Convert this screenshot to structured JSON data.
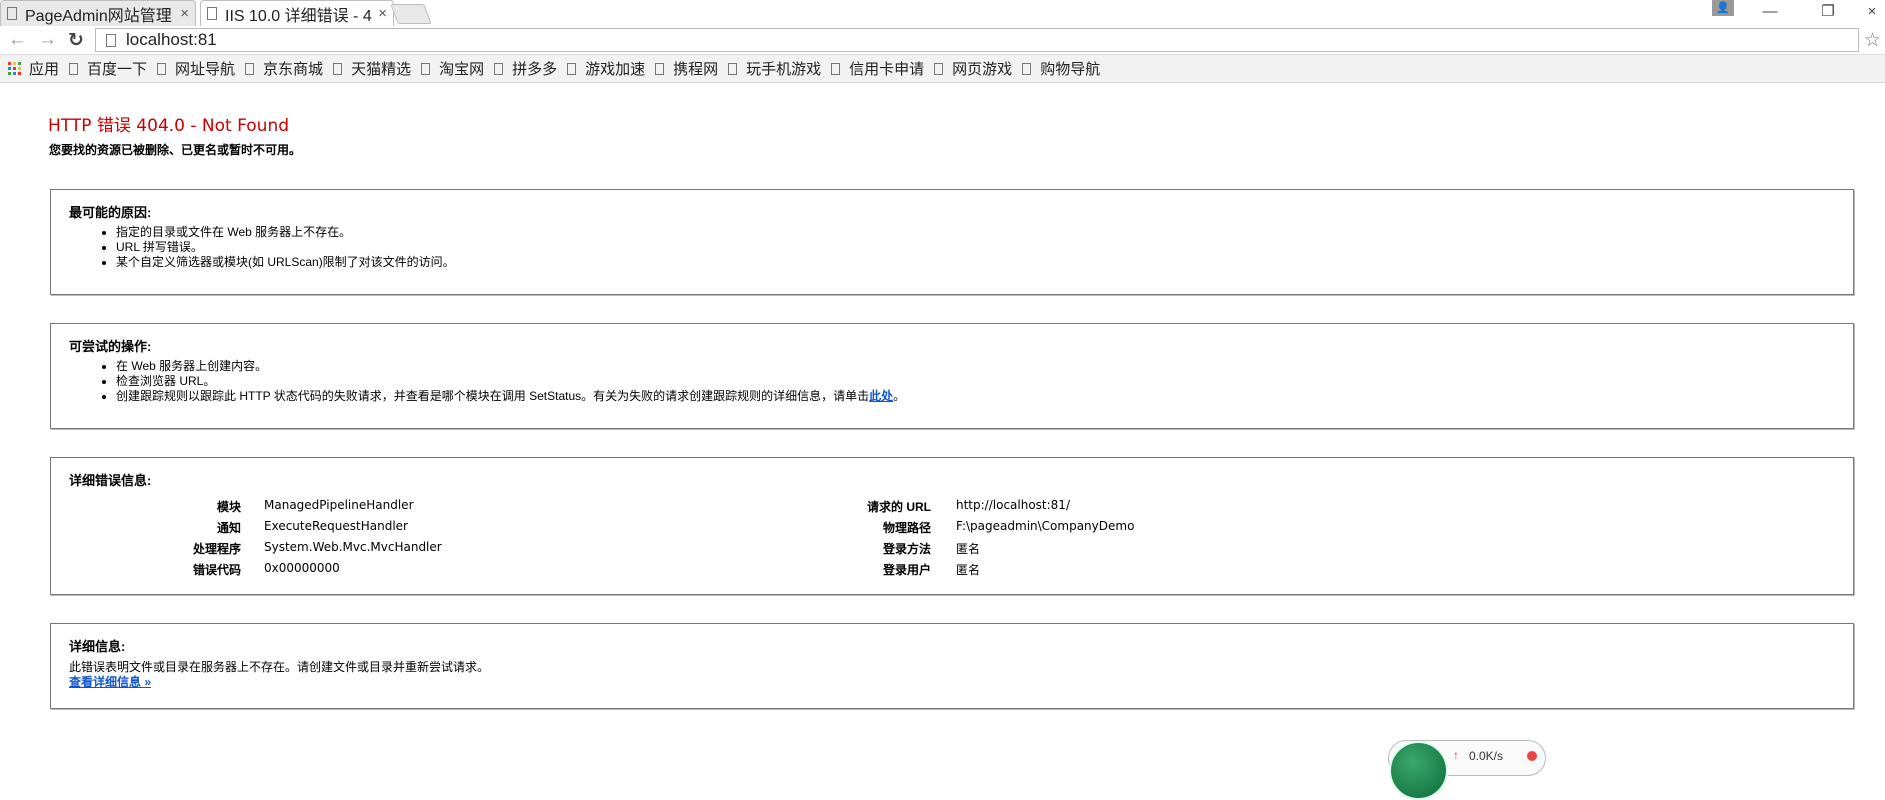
{
  "browser": {
    "tabs": [
      {
        "label": "PageAdmin网站管理",
        "active": false
      },
      {
        "label": "IIS 10.0 详细错误 - 4",
        "active": true
      }
    ],
    "close_glyph": "×",
    "url": "localhost:81",
    "nav": {
      "back": "←",
      "forward": "→",
      "reload": "C"
    },
    "bookmarks": [
      {
        "label": "应用",
        "icon": "apps-grid-icon"
      },
      {
        "label": "百度一下",
        "icon": "page-icon"
      },
      {
        "label": "网址导航",
        "icon": "page-icon"
      },
      {
        "label": "京东商城",
        "icon": "page-icon"
      },
      {
        "label": "天猫精选",
        "icon": "page-icon"
      },
      {
        "label": "淘宝网",
        "icon": "page-icon"
      },
      {
        "label": "拼多多",
        "icon": "page-icon"
      },
      {
        "label": "游戏加速",
        "icon": "page-icon"
      },
      {
        "label": "携程网",
        "icon": "page-icon"
      },
      {
        "label": "玩手机游戏",
        "icon": "page-icon"
      },
      {
        "label": "信用卡申请",
        "icon": "page-icon"
      },
      {
        "label": "网页游戏",
        "icon": "page-icon"
      },
      {
        "label": "购物导航",
        "icon": "page-icon"
      }
    ]
  },
  "page": {
    "title": "HTTP 错误 404.0 - Not Found",
    "subtitle": "您要找的资源已被删除、已更名或暂时不可用。",
    "causes": {
      "heading": "最可能的原因:",
      "items": [
        "指定的目录或文件在 Web 服务器上不存在。",
        "URL 拼写错误。",
        "某个自定义筛选器或模块(如 URLScan)限制了对该文件的访问。"
      ]
    },
    "actions": {
      "heading": "可尝试的操作:",
      "items": [
        "在 Web 服务器上创建内容。",
        "检查浏览器 URL。"
      ],
      "last_item_text": "创建跟踪规则以跟踪此 HTTP 状态代码的失败请求，并查看是哪个模块在调用 SetStatus。有关为失败的请求创建跟踪规则的详细信息，请单击",
      "last_item_link": "此处",
      "last_item_end": "。"
    },
    "details": {
      "heading": "详细错误信息:",
      "left": [
        {
          "key": "模块",
          "value": "ManagedPipelineHandler"
        },
        {
          "key": "通知",
          "value": "ExecuteRequestHandler"
        },
        {
          "key": "处理程序",
          "value": "System.Web.Mvc.MvcHandler"
        },
        {
          "key": "错误代码",
          "value": "0x00000000"
        }
      ],
      "right": [
        {
          "key": "请求的 URL",
          "value": "http://localhost:81/"
        },
        {
          "key": "物理路径",
          "value": "F:\\pageadmin\\CompanyDemo"
        },
        {
          "key": "登录方法",
          "value": "匿名"
        },
        {
          "key": "登录用户",
          "value": "匿名"
        }
      ]
    },
    "more": {
      "heading": "详细信息:",
      "text": "此错误表明文件或目录在服务器上不存在。请创建文件或目录并重新尝试请求。",
      "link": "查看详细信息 »"
    }
  },
  "widget": {
    "percent": "0.0K/s"
  },
  "colors": {
    "error_title": "#cc0000",
    "link": "#1155cc"
  }
}
